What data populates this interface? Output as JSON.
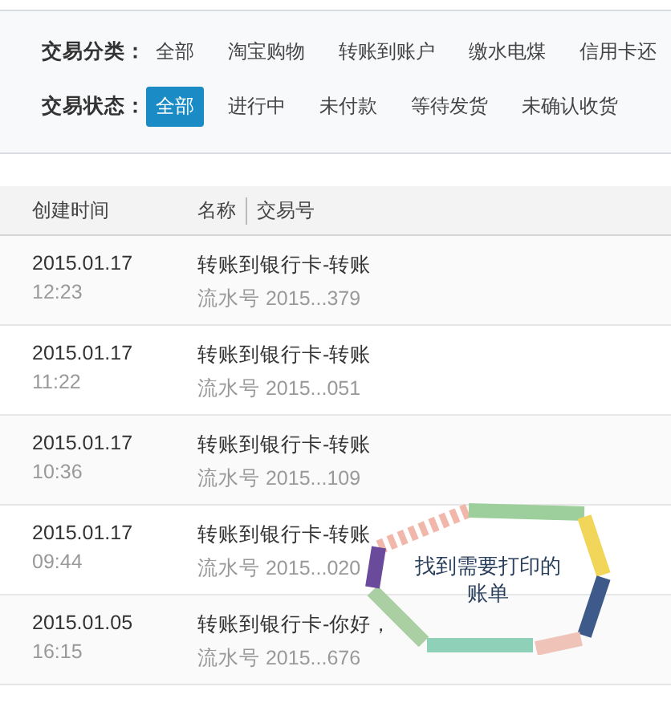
{
  "filters": [
    {
      "label": "交易分类：",
      "options": [
        {
          "text": "全部",
          "selected": false
        },
        {
          "text": "淘宝购物",
          "selected": false
        },
        {
          "text": "转账到账户",
          "selected": false
        },
        {
          "text": "缴水电煤",
          "selected": false
        },
        {
          "text": "信用卡还",
          "selected": false
        }
      ]
    },
    {
      "label": "交易状态：",
      "options": [
        {
          "text": "全部",
          "selected": true
        },
        {
          "text": "进行中",
          "selected": false
        },
        {
          "text": "未付款",
          "selected": false
        },
        {
          "text": "等待发货",
          "selected": false
        },
        {
          "text": "未确认收货",
          "selected": false
        }
      ]
    }
  ],
  "table": {
    "columns": [
      "创建时间",
      "名称",
      "交易号"
    ],
    "rows": [
      {
        "date": "2015.01.17",
        "time": "12:23",
        "name": "转账到银行卡-转账",
        "serial": "流水号 2015...379"
      },
      {
        "date": "2015.01.17",
        "time": "11:22",
        "name": "转账到银行卡-转账",
        "serial": "流水号 2015...051"
      },
      {
        "date": "2015.01.17",
        "time": "10:36",
        "name": "转账到银行卡-转账",
        "serial": "流水号 2015...109"
      },
      {
        "date": "2015.01.17",
        "time": "09:44",
        "name": "转账到银行卡-转账",
        "serial": "流水号 2015...020"
      },
      {
        "date": "2015.01.05",
        "time": "16:15",
        "name": "转账到银行卡-你好，",
        "serial": "流水号 2015...676"
      }
    ]
  },
  "annotation": {
    "text": "找到需要打印的账单"
  }
}
